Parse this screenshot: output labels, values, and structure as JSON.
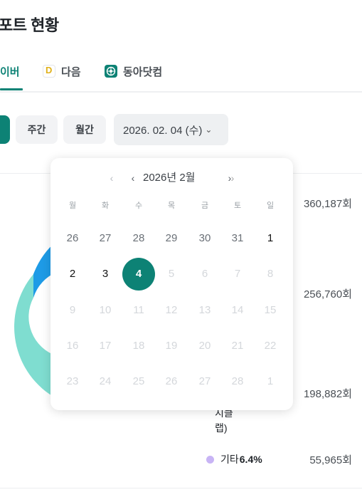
{
  "page": {
    "title": "포트 현황"
  },
  "tabs": [
    {
      "label": "이버"
    },
    {
      "label": "다음"
    },
    {
      "label": "동아닷컴"
    }
  ],
  "filters": {
    "weekly": "주간",
    "monthly": "월간",
    "date": "2026. 02. 04 (수)"
  },
  "calendar": {
    "month_label": "2026년 2월",
    "weekdays": [
      "월",
      "화",
      "수",
      "목",
      "금",
      "토",
      "일"
    ],
    "selected_day": 4,
    "rows": [
      [
        "26",
        "27",
        "28",
        "29",
        "30",
        "31",
        "1"
      ],
      [
        "2",
        "3",
        "4",
        "5",
        "6",
        "7",
        "8"
      ],
      [
        "9",
        "10",
        "11",
        "12",
        "13",
        "14",
        "15"
      ],
      [
        "16",
        "17",
        "18",
        "19",
        "20",
        "21",
        "22"
      ],
      [
        "23",
        "24",
        "25",
        "26",
        "27",
        "28",
        "1"
      ]
    ]
  },
  "stats": {
    "counts": [
      "360,187회",
      "256,760회",
      "198,882회",
      "55,965회"
    ],
    "wrapped_label_line1": "지클",
    "wrapped_label_line2": "랩)",
    "etc_label": "기타",
    "etc_percent": "6.4%"
  },
  "chart_data": {
    "type": "pie",
    "style": "donut",
    "visible_segments": [
      {
        "color": "#1e9be6"
      },
      {
        "color": "#7fddd0"
      }
    ]
  },
  "colors": {
    "accent": "#0d8275",
    "etc_dot": "#c8b4f5"
  }
}
